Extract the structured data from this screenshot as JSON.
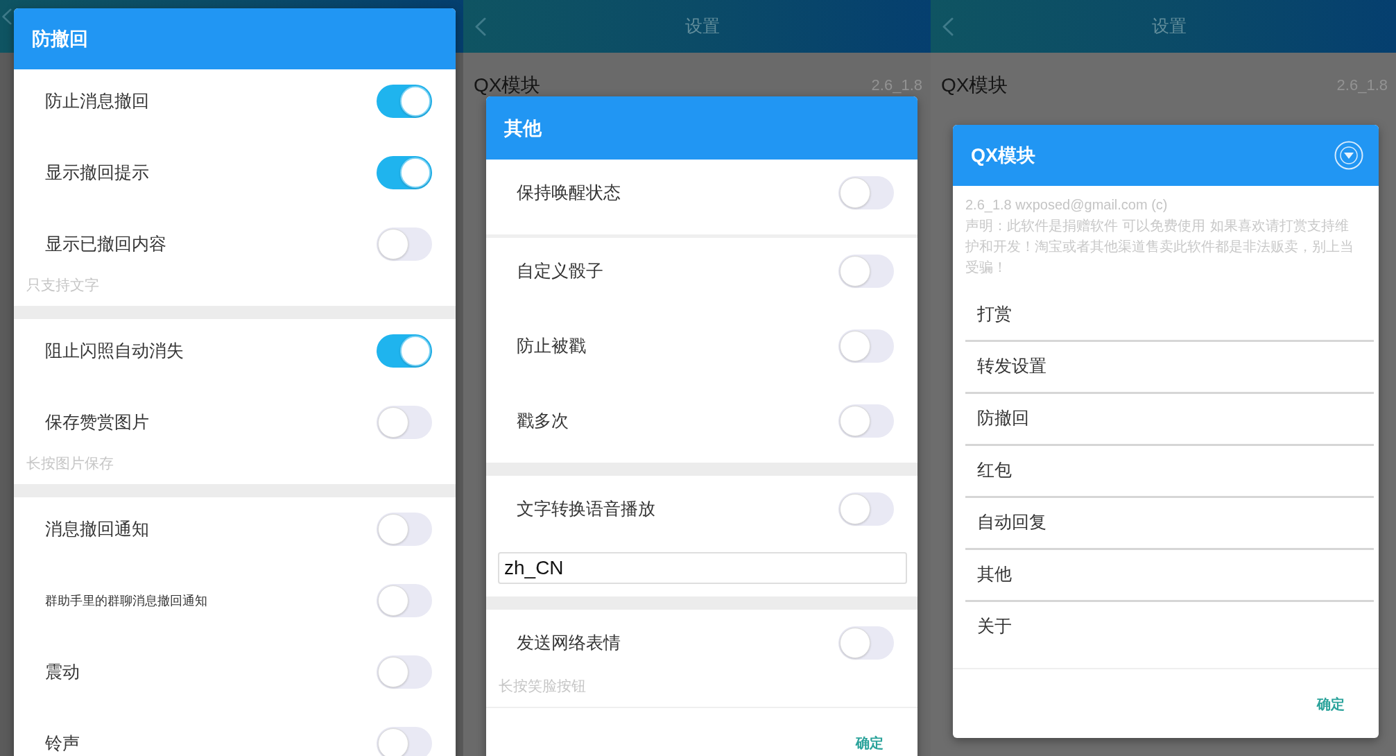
{
  "screens": [
    {
      "dialog": {
        "kind": "settings",
        "title": "防撤回",
        "sections": [
          {
            "items": [
              {
                "label": "防止消息撤回",
                "on": true
              },
              {
                "label": "显示撤回提示",
                "on": true
              },
              {
                "label": "显示已撤回内容",
                "on": false,
                "hint": "只支持文字"
              }
            ]
          },
          {
            "items": [
              {
                "label": "阻止闪照自动消失",
                "on": true
              },
              {
                "label": "保存赞赏图片",
                "on": false,
                "hint": "长按图片保存"
              }
            ]
          },
          {
            "items": [
              {
                "label": "消息撤回通知",
                "on": false
              },
              {
                "label": "群助手里的群聊消息撤回通知",
                "on": false,
                "compact": true
              },
              {
                "label": "震动",
                "on": false
              },
              {
                "label": "铃声",
                "on": false
              }
            ]
          }
        ]
      }
    },
    {
      "app_bar": {
        "title": "设置"
      },
      "list_row": {
        "label": "QX模块",
        "value": "2.6_1.8"
      },
      "dialog": {
        "kind": "settings",
        "title": "其他",
        "sections": [
          {
            "items": [
              {
                "label": "保持唤醒状态",
                "on": false,
                "divider": true
              },
              {
                "label": "自定义骰子",
                "on": false
              },
              {
                "label": "防止被戳",
                "on": false
              },
              {
                "label": "戳多次",
                "on": false
              }
            ]
          },
          {
            "items": [
              {
                "label": "文字转换语音播放",
                "on": false,
                "field": {
                  "value": "zh_CN"
                }
              }
            ]
          },
          {
            "items": [
              {
                "label": "发送网络表情",
                "on": false,
                "hint": "长按笑脸按钮"
              }
            ]
          }
        ],
        "confirm_button": "确定"
      }
    },
    {
      "app_bar": {
        "title": "设置"
      },
      "list_row": {
        "label": "QX模块",
        "value": "2.6_1.8"
      },
      "dialog": {
        "kind": "menu",
        "title": "QX模块",
        "info": "2.6_1.8 wxposed@gmail.com (c)",
        "notice": "声明：此软件是捐赠软件 可以免费使用 如果喜欢请打赏支持维护和开发！淘宝或者其他渠道售卖此软件都是非法贩卖，别上当受骗！",
        "items": [
          "打赏",
          "转发设置",
          "防撤回",
          "红包",
          "自动回复",
          "其他",
          "关于"
        ],
        "confirm_button": "确定"
      }
    }
  ]
}
